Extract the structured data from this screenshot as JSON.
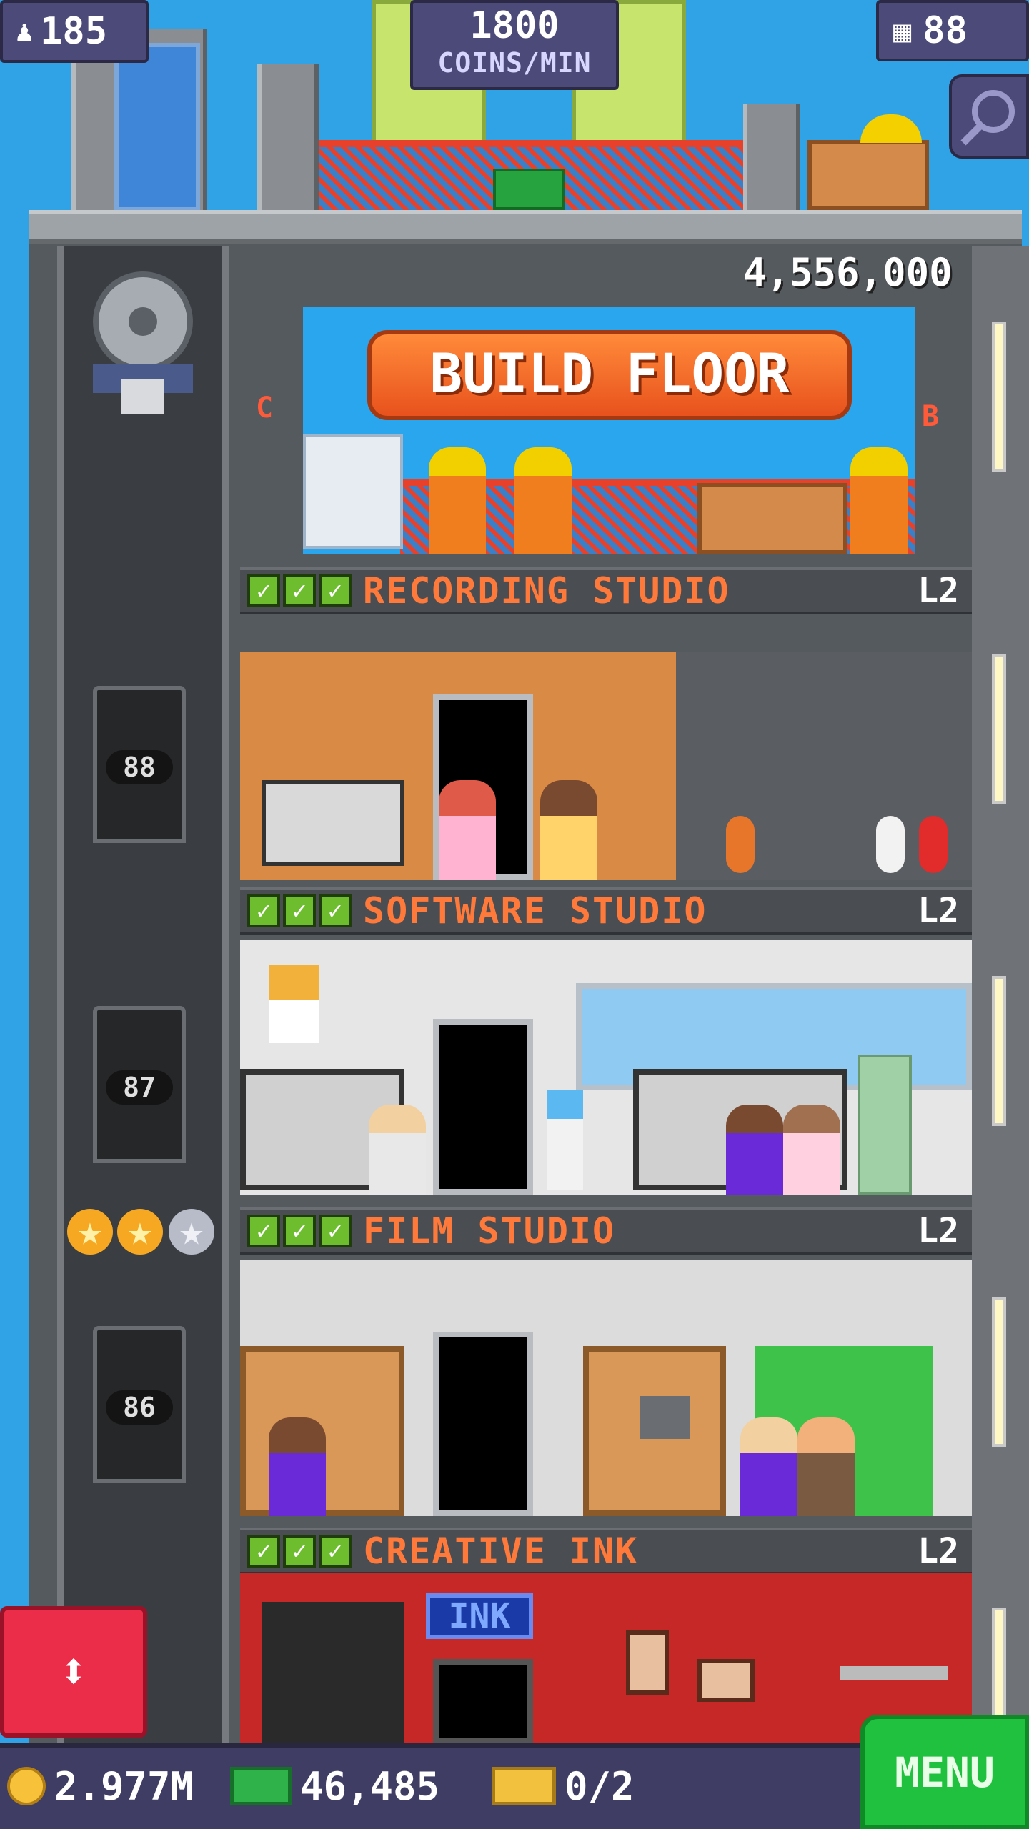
{
  "hud": {
    "population": "185",
    "coins_per_min_value": "1800",
    "coins_per_min_label": "COINS/MIN",
    "floor_count": "88"
  },
  "build": {
    "price": "4,556,000",
    "button_label": "BUILD FLOOR",
    "sign_left": "C",
    "sign_right": "B"
  },
  "floors": [
    {
      "name": "RECORDING STUDIO",
      "level": "L2",
      "stars": 3
    },
    {
      "name": "SOFTWARE STUDIO",
      "level": "L2",
      "stars": 3
    },
    {
      "name": "FILM STUDIO",
      "level": "L2",
      "stars": 3
    },
    {
      "name": "CREATIVE INK",
      "level": "L2",
      "stars": 3
    }
  ],
  "elevator": {
    "floor_numbers": [
      "88",
      "87",
      "86"
    ],
    "stars_filled": 2,
    "stars_total": 3
  },
  "creative_ink_sign": "INK",
  "footer": {
    "coins": "2.977M",
    "bux": "46,485",
    "vip": "0/2",
    "menu_label": "MENU"
  },
  "colors": {
    "sky": "#2fa3e6",
    "label_text": "#ff7a3a",
    "check_green": "#6dbd2f",
    "menu_green": "#1fc13f",
    "elevator_button_red": "#ec2d4a"
  }
}
